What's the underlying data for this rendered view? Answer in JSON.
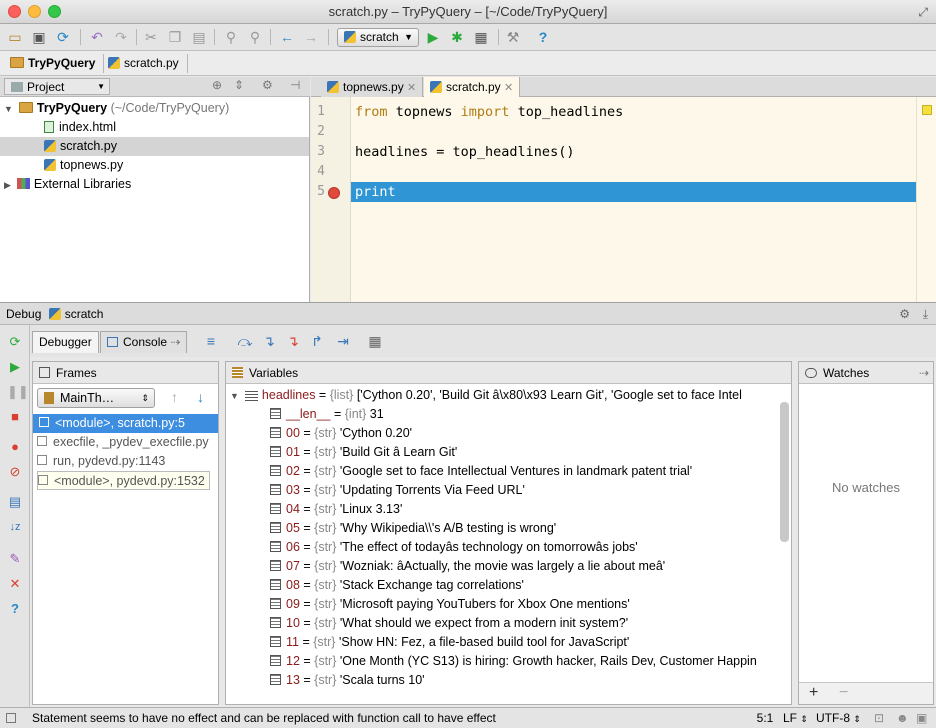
{
  "window": {
    "title": "scratch.py – TryPyQuery – [~/Code/TryPyQuery]"
  },
  "toolbar": {
    "run_config": "scratch"
  },
  "navbar": {
    "project_crumb": "TryPyQuery",
    "file_crumb": "scratch.py"
  },
  "project_panel": {
    "header": "Project",
    "root_name": "TryPyQuery",
    "root_path": "(~/Code/TryPyQuery)",
    "files": [
      "index.html",
      "scratch.py",
      "topnews.py"
    ],
    "external": "External Libraries"
  },
  "editor": {
    "tabs": [
      "topnews.py",
      "scratch.py"
    ],
    "line_numbers": [
      "1",
      "2",
      "3",
      "4",
      "5"
    ],
    "line1": {
      "kw1": "from",
      "mod": " topnews ",
      "kw2": "import",
      "name": " top_headlines"
    },
    "line3": "headlines = top_headlines()",
    "line5": "print"
  },
  "debug": {
    "header_label": "Debug",
    "config": "scratch",
    "tabs": {
      "debugger": "Debugger",
      "console": "Console"
    },
    "frames": {
      "header": "Frames",
      "thread": "MainTh…",
      "items": [
        "<module>, scratch.py:5",
        "execfile, _pydev_execfile.py",
        "run, pydevd.py:1143",
        "<module>, pydevd.py:1532"
      ]
    },
    "variables": {
      "header": "Variables",
      "root": {
        "name": "headlines",
        "type": "{list}",
        "value": "['Cython 0.20', 'Build Git â\\x80\\x93 Learn Git', 'Google set to face Intel"
      },
      "len": {
        "name": "__len__",
        "type": "{int}",
        "value": "31"
      },
      "items": [
        {
          "name": "00",
          "type": "{str}",
          "value": "'Cython 0.20'"
        },
        {
          "name": "01",
          "type": "{str}",
          "value": "'Build Git â Learn Git'"
        },
        {
          "name": "02",
          "type": "{str}",
          "value": "'Google set to face Intellectual Ventures in landmark patent trial'"
        },
        {
          "name": "03",
          "type": "{str}",
          "value": "'Updating Torrents Via Feed URL'"
        },
        {
          "name": "04",
          "type": "{str}",
          "value": "'Linux 3.13'"
        },
        {
          "name": "05",
          "type": "{str}",
          "value": "'Why Wikipedia\\\\'s A/B testing is wrong'"
        },
        {
          "name": "06",
          "type": "{str}",
          "value": "'The effect of todayâs technology on tomorrowâs jobs'"
        },
        {
          "name": "07",
          "type": "{str}",
          "value": "'Wozniak: âActually, the movie was largely a lie about meâ'"
        },
        {
          "name": "08",
          "type": "{str}",
          "value": "'Stack Exchange tag correlations'"
        },
        {
          "name": "09",
          "type": "{str}",
          "value": "'Microsoft paying YouTubers for Xbox One mentions'"
        },
        {
          "name": "10",
          "type": "{str}",
          "value": "'What should we expect from a modern init system?'"
        },
        {
          "name": "11",
          "type": "{str}",
          "value": "'Show HN: Fez, a file-based build tool for JavaScript'"
        },
        {
          "name": "12",
          "type": "{str}",
          "value": "'One Month (YC S13) is hiring: Growth hacker, Rails Dev, Customer Happin"
        },
        {
          "name": "13",
          "type": "{str}",
          "value": "'Scala turns 10'"
        }
      ]
    },
    "watches": {
      "header": "Watches",
      "empty": "No watches",
      "add": "+",
      "remove": "−"
    }
  },
  "status": {
    "message": "Statement seems to have no effect and can be replaced with function call to have effect",
    "position": "5:1",
    "line_sep": "LF",
    "encoding": "UTF-8"
  },
  "colors": {
    "selection": "#3d8ee0",
    "editor_bg": "#fdf8ea",
    "current_line": "#2f95d4",
    "breakpoint": "#e0493b"
  }
}
